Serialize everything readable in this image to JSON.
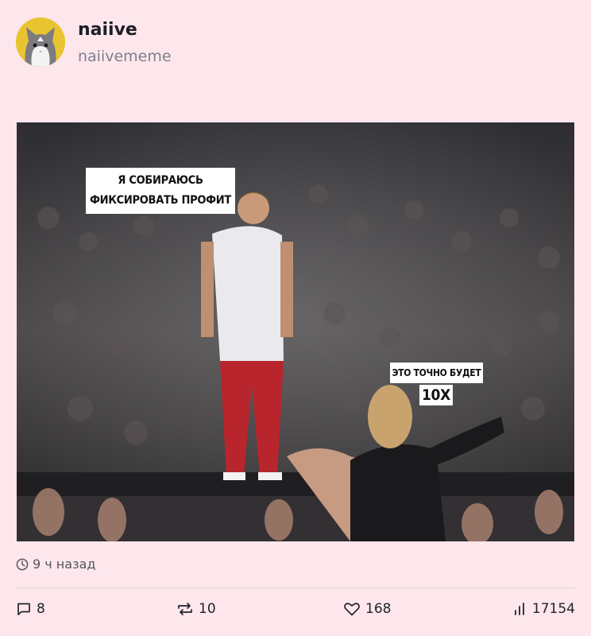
{
  "post": {
    "author": {
      "display_name": "naiive",
      "handle": "naiivememe",
      "avatar_icon": "cat-avatar-icon"
    },
    "meme": {
      "caption_left": "Я СОБИРАЮСЬ ФИКСИРОВАТЬ ПРОФИТ",
      "caption_right_top": "ЭТО ТОЧНО БУДЕТ",
      "caption_right_bottom": "10X"
    },
    "timestamp": "9 ч назад",
    "actions": {
      "replies": "8",
      "reposts": "10",
      "likes": "168",
      "views": "17154"
    }
  },
  "colors": {
    "background": "#fde7ed",
    "avatar_bg": "#e8c530",
    "text_primary": "#1d1d26",
    "text_secondary": "#7d7f8c"
  }
}
